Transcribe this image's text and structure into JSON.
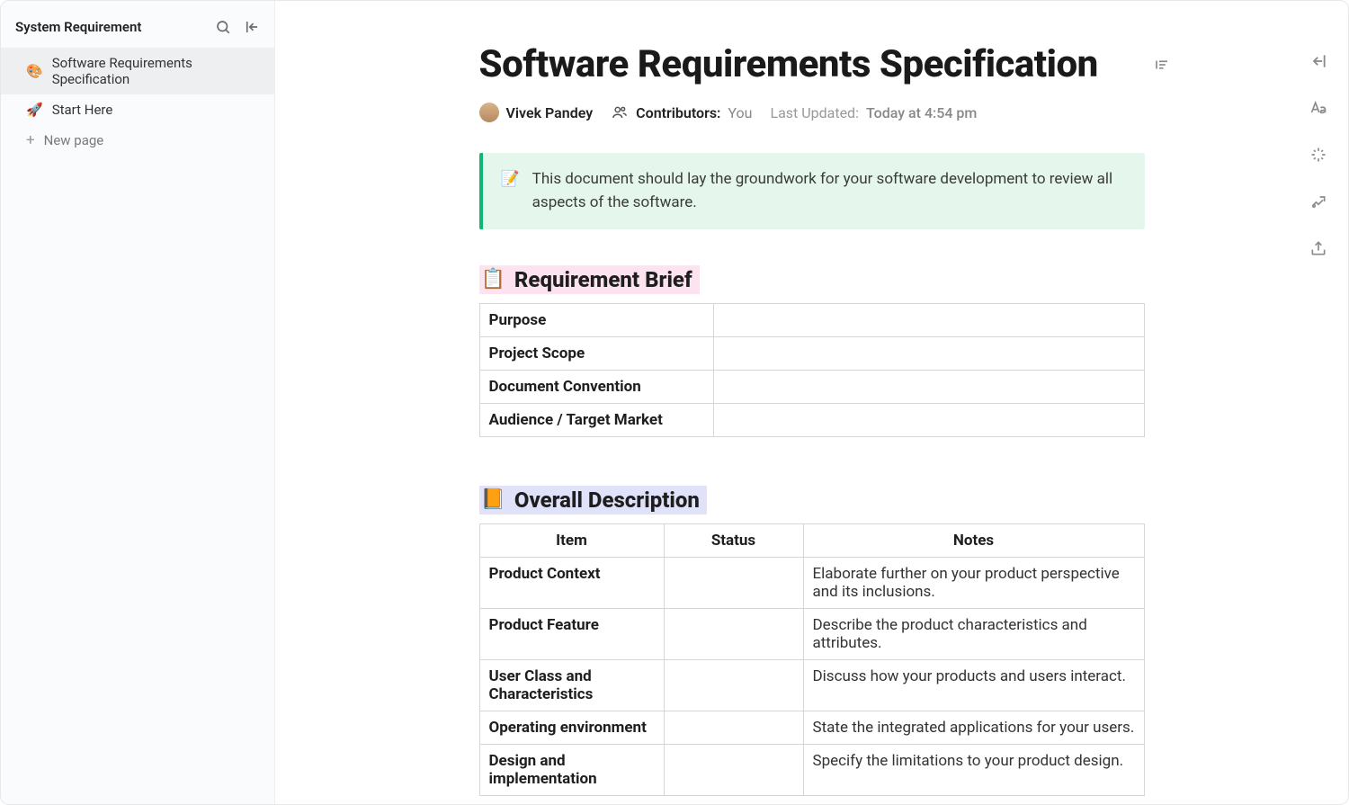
{
  "sidebar": {
    "workspace_title": "System Requirement",
    "items": [
      {
        "emoji": "🎨",
        "label": "Software Requirements Specification",
        "active": true
      },
      {
        "emoji": "🚀",
        "label": "Start Here",
        "active": false
      }
    ],
    "new_page_label": "New page"
  },
  "doc": {
    "title": "Software Requirements Specification",
    "author": "Vivek Pandey",
    "contributors_label": "Contributors:",
    "contributors_value": "You",
    "updated_label": "Last Updated:",
    "updated_value": "Today at 4:54 pm",
    "callout_emoji": "📝",
    "callout_text": "This document should lay the groundwork for your software development to review all aspects of the software.",
    "section1": {
      "emoji": "📋",
      "title": "Requirement Brief",
      "rows": [
        {
          "label": "Purpose",
          "value": ""
        },
        {
          "label": "Project Scope",
          "value": ""
        },
        {
          "label": "Document Convention",
          "value": ""
        },
        {
          "label": "Audience / Target Market",
          "value": ""
        }
      ]
    },
    "section2": {
      "emoji": "📙",
      "title": "Overall Description",
      "headers": [
        "Item",
        "Status",
        "Notes"
      ],
      "rows": [
        {
          "item": "Product Context",
          "status": "",
          "notes": "Elaborate further on your product perspective and its inclusions."
        },
        {
          "item": "Product Feature",
          "status": "",
          "notes": "Describe the product characteristics and attributes."
        },
        {
          "item": "User Class and Characteristics",
          "status": "",
          "notes": "Discuss how your products and users interact."
        },
        {
          "item": "Operating environment",
          "status": "",
          "notes": "State the integrated applications for your users."
        },
        {
          "item": "Design and implementation",
          "status": "",
          "notes": "Specify the limitations to your product design."
        }
      ]
    }
  }
}
